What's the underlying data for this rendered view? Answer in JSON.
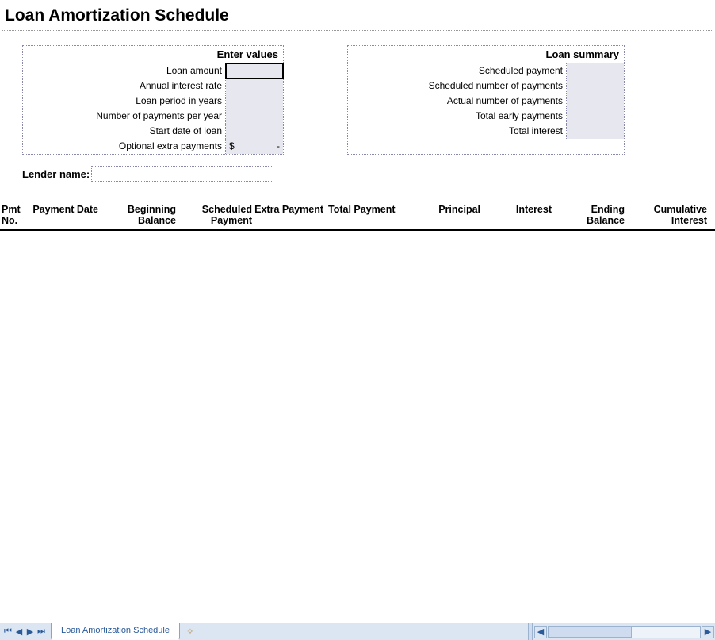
{
  "title": "Loan Amortization Schedule",
  "enter_values": {
    "header": "Enter values",
    "rows": [
      {
        "label": "Loan amount",
        "value": ""
      },
      {
        "label": "Annual interest rate",
        "value": ""
      },
      {
        "label": "Loan period in years",
        "value": ""
      },
      {
        "label": "Number of payments per year",
        "value": ""
      },
      {
        "label": "Start date of loan",
        "value": ""
      }
    ],
    "extra_label": "Optional extra payments",
    "extra_currency": "$",
    "extra_value": "-"
  },
  "loan_summary": {
    "header": "Loan summary",
    "rows": [
      {
        "label": "Scheduled payment",
        "value": ""
      },
      {
        "label": "Scheduled number of payments",
        "value": ""
      },
      {
        "label": "Actual number of payments",
        "value": ""
      },
      {
        "label": "Total early payments",
        "value": ""
      },
      {
        "label": "Total interest",
        "value": ""
      }
    ]
  },
  "lender": {
    "label": "Lender name:",
    "value": ""
  },
  "schedule_columns": {
    "pmt_no": "Pmt No.",
    "payment_date": "Payment Date",
    "beginning_balance": "Beginning Balance",
    "scheduled_payment": "Scheduled Payment",
    "extra_payment": "Extra Payment",
    "total_payment": "Total Payment",
    "principal": "Principal",
    "interest": "Interest",
    "ending_balance": "Ending Balance",
    "cumulative_interest": "Cumulative Interest"
  },
  "tabbar": {
    "sheet_name": "Loan Amortization Schedule"
  }
}
